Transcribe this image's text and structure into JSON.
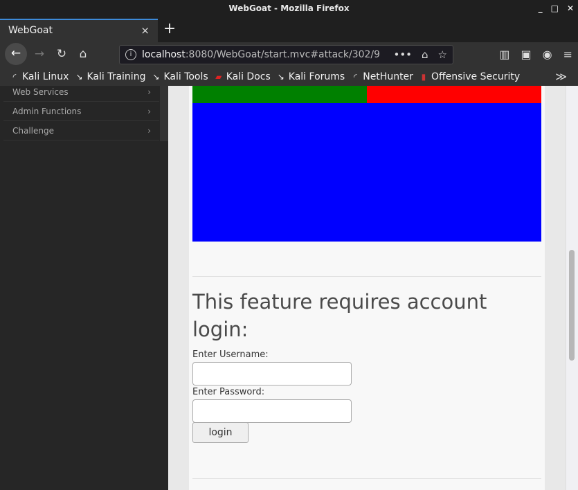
{
  "window": {
    "title": "WebGoat - Mozilla Firefox"
  },
  "tab": {
    "title": "WebGoat",
    "close": "×",
    "new_tab": "+"
  },
  "navigation": {
    "back": "←",
    "forward": "→",
    "reload": "↻",
    "home": "⌂",
    "url_host": "localhost",
    "url_path": ":8080/WebGoat/start.mvc#attack/302/9",
    "info_icon": "i",
    "page_actions": "•••",
    "pocket_icon": "⌂",
    "bookmark_star": "☆",
    "library_icon": "▥",
    "sidebar_icon": "▣",
    "account_icon": "◉",
    "menu_icon": "≡"
  },
  "bookmarks": [
    {
      "label": "Kali Linux",
      "icon": "◜"
    },
    {
      "label": "Kali Training",
      "icon": "↘"
    },
    {
      "label": "Kali Tools",
      "icon": "↘"
    },
    {
      "label": "Kali Docs",
      "icon": "▰"
    },
    {
      "label": "Kali Forums",
      "icon": "↘"
    },
    {
      "label": "NetHunter",
      "icon": "◜"
    },
    {
      "label": "Offensive Security",
      "icon": "▮"
    }
  ],
  "bookmarks_overflow": "≫",
  "sidebar": {
    "items": [
      {
        "label": "Web Services",
        "chevron": "›"
      },
      {
        "label": "Admin Functions",
        "chevron": "›"
      },
      {
        "label": "Challenge",
        "chevron": "›"
      }
    ]
  },
  "colors": {
    "green": "#008000",
    "red": "#ff0000",
    "blue": "#0000ff"
  },
  "login": {
    "heading": "This feature requires account login:",
    "username_label": "Enter Username:",
    "username_value": "",
    "password_label": "Enter Password:",
    "password_value": "",
    "button": "login"
  },
  "window_controls": {
    "minimize": "_",
    "maximize": "□",
    "close": "✕"
  }
}
